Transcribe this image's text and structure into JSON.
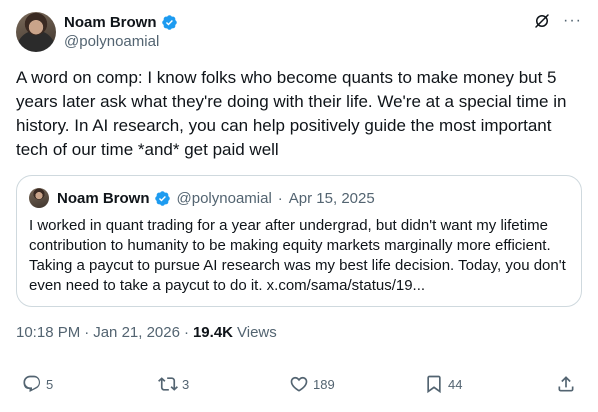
{
  "tweet": {
    "author_name": "Noam Brown",
    "author_handle": "@polynoamial",
    "text": "A word on comp: I know folks who become quants to make money but 5 years later ask what they're doing with their life. We're at a special time in history. In AI research, you can help positively guide the most important tech of our time *and* get paid well",
    "time": "10:18 PM",
    "date": "Jan 21, 2026",
    "views_count": "19.4K",
    "views_label": "Views"
  },
  "quote": {
    "author_name": "Noam Brown",
    "author_handle": "@polynoamial",
    "date": "Apr 15, 2025",
    "text": "I worked in quant trading for a year after undergrad, but didn't want my lifetime contribution to humanity to be making equity markets marginally more efficient. Taking a paycut to pursue AI research was my best life decision. Today, you don't even need to take a paycut to do it. x.com/sama/status/19..."
  },
  "actions": {
    "replies": "5",
    "reposts": "3",
    "likes": "189",
    "bookmarks": "44"
  },
  "icons": {
    "verified": "verified-badge-icon",
    "grok": "grok-icon",
    "more": "more-icon",
    "reply": "reply-icon",
    "repost": "repost-icon",
    "like": "heart-icon",
    "bookmark": "bookmark-icon",
    "share": "share-icon"
  },
  "colors": {
    "verified_blue": "#1d9bf0",
    "secondary_text": "#536471",
    "border": "#cfd9de"
  }
}
